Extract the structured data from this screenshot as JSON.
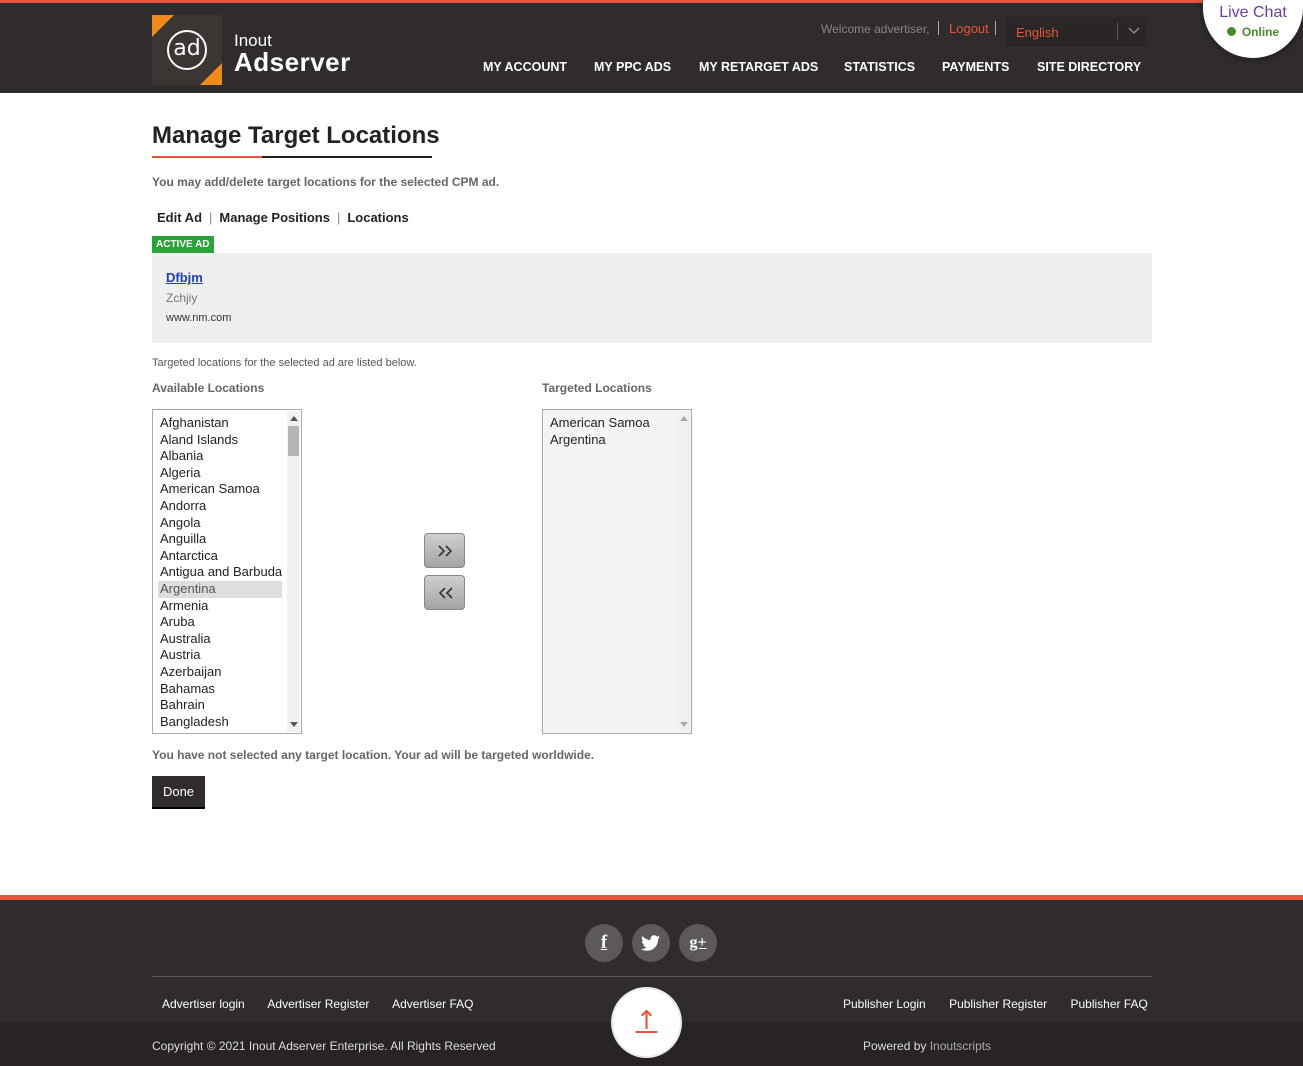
{
  "brand": {
    "logo_mark": "ad",
    "name_small": "Inout",
    "name_big": "Adserver"
  },
  "topbar": {
    "welcome": "Welcome advertiser,",
    "logout": "Logout",
    "language": "English"
  },
  "livechat": {
    "title": "Live Chat",
    "status": "Online"
  },
  "nav": [
    "MY ACCOUNT",
    "MY PPC ADS",
    "MY RETARGET ADS",
    "STATISTICS",
    "PAYMENTS",
    "SITE DIRECTORY"
  ],
  "page": {
    "title": "Manage Target Locations",
    "description": "You may add/delete target locations for the selected CPM ad.",
    "tabs": [
      "Edit Ad",
      "Manage Positions",
      "Locations"
    ],
    "badge": "ACTIVE AD"
  },
  "ad": {
    "title": "Dfbjm",
    "description": "Zchjiy",
    "url": "www.nm.com"
  },
  "locations": {
    "note": "Targeted locations for the selected ad are listed below.",
    "available_label": "Available Locations",
    "targeted_label": "Targeted Locations",
    "available": [
      "Afghanistan",
      "Aland Islands",
      "Albania",
      "Algeria",
      "American Samoa",
      "Andorra",
      "Angola",
      "Anguilla",
      "Antarctica",
      "Antigua and Barbuda",
      "Argentina",
      "Armenia",
      "Aruba",
      "Australia",
      "Austria",
      "Azerbaijan",
      "Bahamas",
      "Bahrain",
      "Bangladesh"
    ],
    "available_selected": "Argentina",
    "targeted": [
      "American Samoa",
      "Argentina"
    ],
    "worldwide_note": "You have not selected any target location. Your ad will be targeted worldwide.",
    "done_label": "Done"
  },
  "footer": {
    "social": [
      {
        "name": "facebook-icon",
        "glyph": "f"
      },
      {
        "name": "twitter-icon",
        "glyph": "t"
      },
      {
        "name": "google-plus-icon",
        "glyph": "g+"
      }
    ],
    "left_links": [
      "Advertiser login",
      "Advertiser Register",
      "Advertiser FAQ"
    ],
    "right_links": [
      "Publisher Login",
      "Publisher Register",
      "Publisher FAQ"
    ],
    "copyright": "Copyright © 2021 Inout Adserver Enterprise. All Rights Reserved",
    "powered_prefix": "Powered by",
    "powered_link": "Inoutscripts",
    "to_top": "↑"
  },
  "colors": {
    "accent": "#e8543c",
    "header_bg": "#302c2b",
    "badge": "#2aa43a",
    "link_blue": "#1f3fb5"
  }
}
